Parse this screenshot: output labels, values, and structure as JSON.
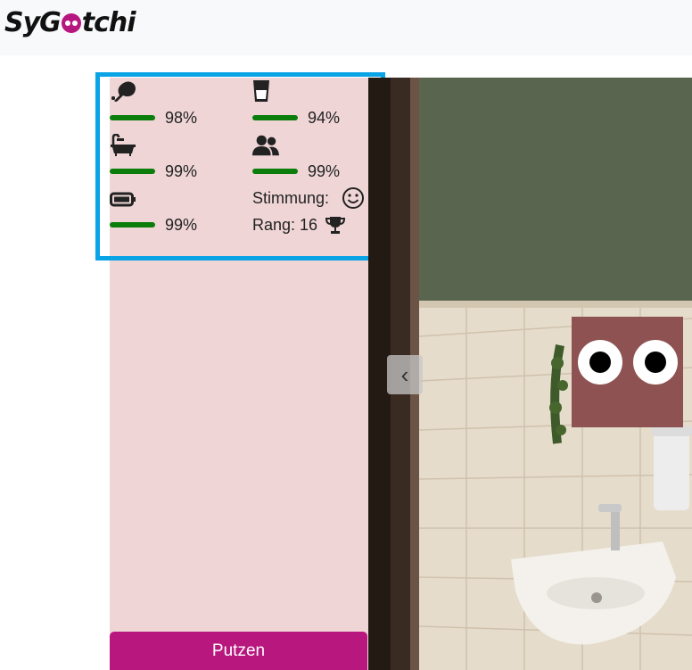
{
  "app": {
    "logo_text_left": "SyG",
    "logo_text_right": "tchi",
    "logo_full": "SyGotchi"
  },
  "stats": {
    "hunger": {
      "icon": "drumstick-icon",
      "percent": "98%",
      "level": 0.98
    },
    "thirst": {
      "icon": "glass-icon",
      "percent": "94%",
      "level": 0.94
    },
    "hygiene": {
      "icon": "bath-icon",
      "percent": "99%",
      "level": 0.99
    },
    "social": {
      "icon": "users-icon",
      "percent": "99%",
      "level": 0.99
    },
    "energy": {
      "icon": "battery-icon",
      "percent": "99%",
      "level": 0.99
    }
  },
  "mood": {
    "label": "Stimmung:",
    "icon": "smile-icon"
  },
  "rank": {
    "label": "Rang: 16",
    "icon": "trophy-icon"
  },
  "actions": {
    "clean_label": "Putzen"
  },
  "carousel": {
    "prev_glyph": "‹"
  },
  "colors": {
    "panel_bg": "#efd5d6",
    "bar_green": "#0b7d0b",
    "button_magenta": "#b8187e",
    "highlight_blue": "#0aa3e6",
    "creature": "#8e5252"
  }
}
